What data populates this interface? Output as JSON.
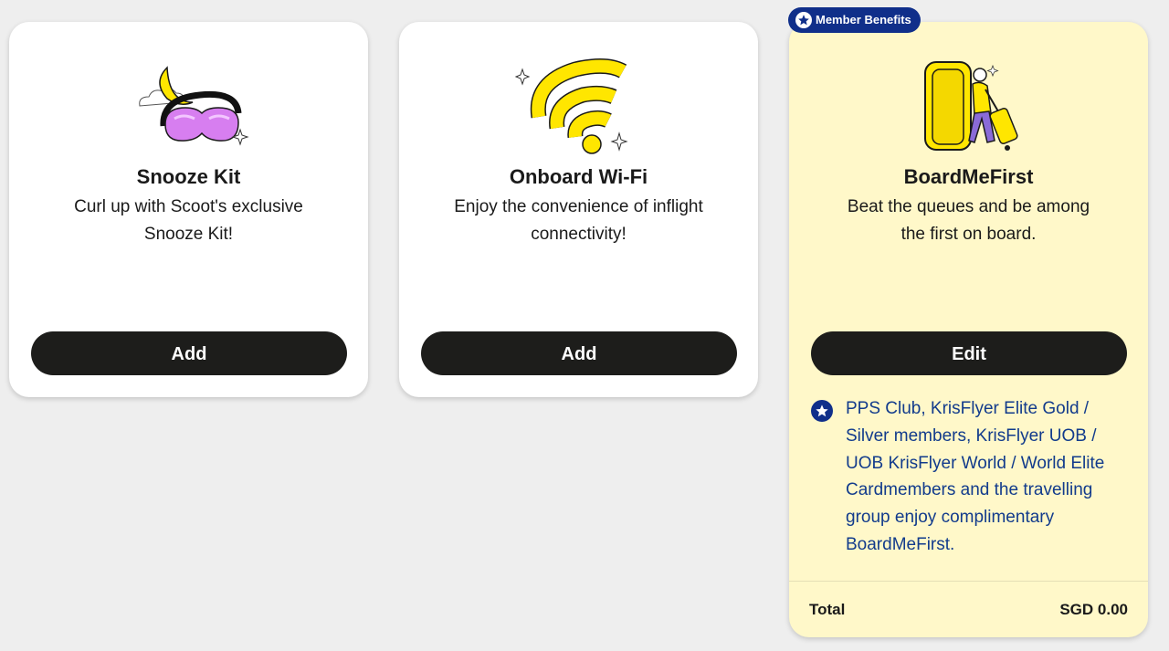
{
  "cards": [
    {
      "title": "Snooze Kit",
      "description": "Curl up with Scoot's exclusive Snooze Kit!",
      "button_label": "Add",
      "illustration": "sleep-mask-moon-illustration"
    },
    {
      "title": "Onboard Wi-Fi",
      "description": "Enjoy the convenience of inflight connectivity!",
      "button_label": "Add",
      "illustration": "wifi-signal-illustration"
    },
    {
      "title": "BoardMeFirst",
      "description": "Beat the queues and be among the first on board.",
      "button_label": "Edit",
      "illustration": "traveller-boarding-illustration",
      "badge": "Member Benefits",
      "benefit_text": "PPS Club, KrisFlyer Elite Gold / Silver members, KrisFlyer UOB / UOB KrisFlyer World / World Elite Cardmembers and the travelling group enjoy complimentary BoardMeFirst.",
      "total_label": "Total",
      "total_value": "SGD 0.00"
    }
  ],
  "colors": {
    "page_bg": "#eeeeee",
    "card_bg": "#ffffff",
    "highlight_card_bg": "#fff8c9",
    "button_bg": "#1d1d1b",
    "badge_bg": "#102f8a",
    "benefit_text": "#123b8c",
    "accent_yellow": "#ffe600",
    "accent_purple": "#d77ef0"
  }
}
